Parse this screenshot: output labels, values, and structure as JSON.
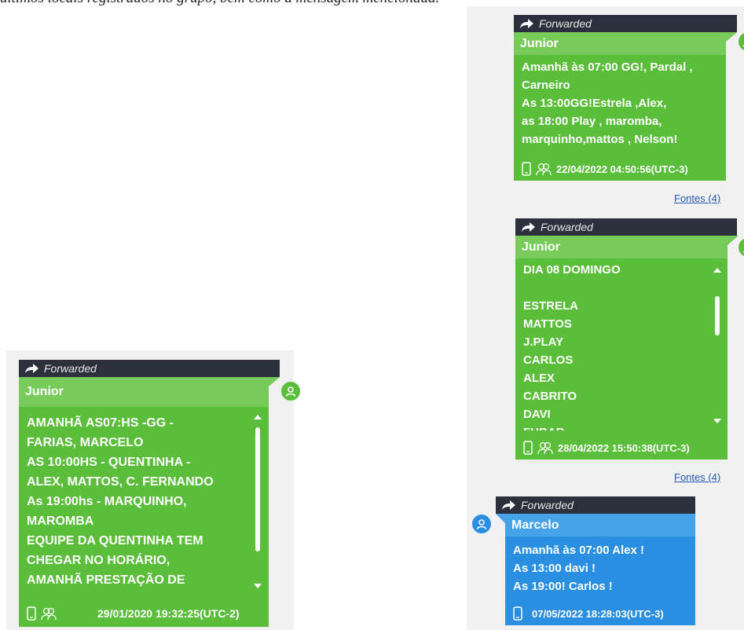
{
  "caption": "últimos locais registrados no grupo, bem como a mensagem mencionada.",
  "forward_label": "Forwarded",
  "messages": [
    {
      "sender": "Junior",
      "lines": [
        "Amanhã às 07:00 GG!, Pardal ,",
        "Carneiro",
        "As 13:00GG!Estrela ,Alex,",
        "as 18:00 Play , maromba,",
        "marquinho,mattos , Nelson!"
      ],
      "timestamp": "22/04/2022 04:50:56(UTC-3)",
      "sources_link": "Fontes (4)"
    },
    {
      "sender": "Junior",
      "lines": [
        "DIA 08 DOMINGO",
        "",
        "ESTRELA",
        "MATTOS",
        "J.PLAY",
        "CARLOS",
        "ALEX",
        "CABRITO",
        "DAVI",
        "FUBAR"
      ],
      "timestamp": "28/04/2022 15:50:38(UTC-3)",
      "sources_link": "Fontes (4)"
    },
    {
      "sender": "Marcelo",
      "lines": [
        "Amanhã às 07:00 Alex !",
        "As 13:00 davi !",
        "As 19:00! Carlos !"
      ],
      "timestamp": "07/05/2022 18:28:03(UTC-3)"
    },
    {
      "sender": "Junior",
      "lines": [
        "AMANHÃ AS07:HS -GG -",
        "FARIAS, MARCELO",
        "AS 10:00HS - QUENTINHA -",
        "ALEX, MATTOS, C. FERNANDO",
        "As 19:00hs - MARQUINHO,",
        "MAROMBA",
        "EQUIPE DA QUENTINHA TEM",
        "CHEGAR NO HORÁRIO,",
        "AMANHÃ PRESTAÇÃO DE"
      ],
      "timestamp": "29/01/2020 19:32:25(UTC-2)"
    }
  ],
  "colors": {
    "green": "#5bbe3b",
    "green_header": "#77cb59",
    "blue": "#2a8fe0",
    "blue_header": "#46a3ea",
    "forward_bar": "#2c2f3c",
    "link": "#2659b8"
  },
  "icons": [
    "forward-arrow-icon",
    "phone-icon",
    "group-icon",
    "user-avatar-icon"
  ]
}
